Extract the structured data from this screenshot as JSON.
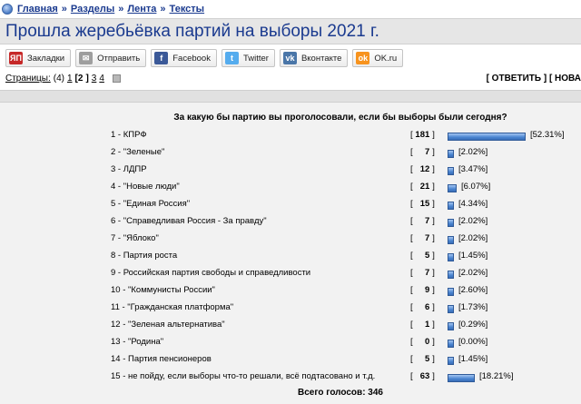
{
  "breadcrumb": {
    "items": [
      "Главная",
      "Разделы",
      "Лента",
      "Тексты"
    ],
    "sep": "»"
  },
  "title": "Прошла жеребьёвка партий на выборы 2021 г.",
  "share_buttons": [
    {
      "label": "Закладки",
      "icon": "bookmarks-icon",
      "color": "#c62828",
      "glyph": "ЯП"
    },
    {
      "label": "Отправить",
      "icon": "mail-icon",
      "color": "#9e9e9e",
      "glyph": "✉"
    },
    {
      "label": "Facebook",
      "icon": "facebook-icon",
      "color": "#3b5998",
      "glyph": "f"
    },
    {
      "label": "Twitter",
      "icon": "twitter-icon",
      "color": "#55acee",
      "glyph": "t"
    },
    {
      "label": "Вконтакте",
      "icon": "vk-icon",
      "color": "#4a76a8",
      "glyph": "vk"
    },
    {
      "label": "OK.ru",
      "icon": "ok-icon",
      "color": "#f7931e",
      "glyph": "ok"
    }
  ],
  "pager": {
    "label": "Страницы:",
    "count": "(4)",
    "pages": [
      "1",
      "2",
      "3",
      "4"
    ],
    "current": "2"
  },
  "actions": {
    "text": "[ ОТВЕТИТЬ ] [ НОВА"
  },
  "poll": {
    "question": "За какую бы партию вы проголосовали, если бы выборы были сегодня?",
    "options": [
      {
        "label": "1 - КПРФ",
        "count": "181",
        "pct": "[52.31%]",
        "pct_value": 52.31
      },
      {
        "label": "2 - \"Зеленые\"",
        "count": "7",
        "pct": "[2.02%]",
        "pct_value": 2.02
      },
      {
        "label": "3 - ЛДПР",
        "count": "12",
        "pct": "[3.47%]",
        "pct_value": 3.47
      },
      {
        "label": "4 - \"Новые люди\"",
        "count": "21",
        "pct": "[6.07%]",
        "pct_value": 6.07
      },
      {
        "label": "5 - \"Единая Россия\"",
        "count": "15",
        "pct": "[4.34%]",
        "pct_value": 4.34
      },
      {
        "label": "6 - \"Справедливая Россия - За правду\"",
        "count": "7",
        "pct": "[2.02%]",
        "pct_value": 2.02
      },
      {
        "label": "7 - \"Яблоко\"",
        "count": "7",
        "pct": "[2.02%]",
        "pct_value": 2.02
      },
      {
        "label": "8 - Партия роста",
        "count": "5",
        "pct": "[1.45%]",
        "pct_value": 1.45
      },
      {
        "label": "9 - Российская партия свободы и справедливости",
        "count": "7",
        "pct": "[2.02%]",
        "pct_value": 2.02
      },
      {
        "label": "10 - \"Коммунисты России\"",
        "count": "9",
        "pct": "[2.60%]",
        "pct_value": 2.6
      },
      {
        "label": "11 - \"Гражданская платформа\"",
        "count": "6",
        "pct": "[1.73%]",
        "pct_value": 1.73
      },
      {
        "label": "12 - \"Зеленая альтернатива\"",
        "count": "1",
        "pct": "[0.29%]",
        "pct_value": 0.29
      },
      {
        "label": "13 - \"Родина\"",
        "count": "0",
        "pct": "[0.00%]",
        "pct_value": 0
      },
      {
        "label": "14 - Партия пенсионеров",
        "count": "5",
        "pct": "[1.45%]",
        "pct_value": 1.45
      },
      {
        "label": "15 - не пойду, если выборы что-то решали, всё подтасовано и т.д.",
        "count": "63",
        "pct": "[18.21%]",
        "pct_value": 18.21
      }
    ],
    "total": "Всего голосов: 346"
  }
}
